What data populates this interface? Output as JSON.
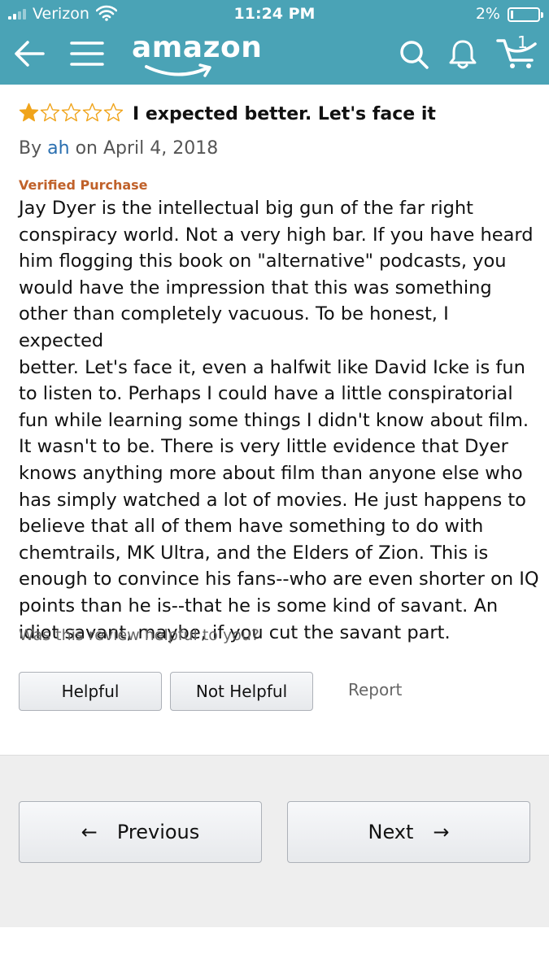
{
  "status_bar": {
    "carrier": "Verizon",
    "time": "11:24 PM",
    "battery": "2%"
  },
  "nav": {
    "logo": "amazon",
    "cart_count": "1",
    "icons": [
      "back-arrow-icon",
      "menu-icon",
      "search-icon",
      "bell-icon",
      "cart-icon"
    ]
  },
  "review": {
    "rating": 1,
    "max_rating": 5,
    "title": "I expected better. Let's face it",
    "by_prefix": "By",
    "author": "ah",
    "date": "on April 4, 2018",
    "verified": "Verified Purchase",
    "lines": [
      "Jay Dyer is the intellectual big gun of the far right",
      "conspiracy world. Not a very high bar. If you have heard",
      "him flogging this book on \"alternative\" podcasts, you",
      "would have the impression that this was something",
      "other than completely vacuous. To be honest, I expected",
      "better. Let's face it, even a halfwit like David Icke is fun",
      "to listen to. Perhaps I could have a little conspiratorial",
      "fun while learning some things I didn't know about film.",
      "It wasn't to be. There is very little evidence that Dyer",
      "knows anything more about film than anyone else who",
      "has simply watched a lot of movies. He just happens to",
      "believe that all of them have something to do with",
      "chemtrails, MK Ultra, and the Elders of Zion. This is",
      "enough to convince his fans--who are even shorter on IQ",
      "points than he is--that he is some kind of savant. An",
      "idiot savant, maybe, if you cut the savant part."
    ],
    "helpful_question": "Was this review helpful to you?",
    "helpful_label": "Helpful",
    "not_helpful_label": "Not Helpful",
    "report_label": "Report"
  },
  "pager": {
    "previous_label": "Previous",
    "next_label": "Next",
    "prev_arrow": "←",
    "next_arrow": "→"
  },
  "colors": {
    "header": "#4aa3b6",
    "star": "#f0a41b",
    "verified": "#c0612a",
    "link": "#2a6fb0"
  }
}
